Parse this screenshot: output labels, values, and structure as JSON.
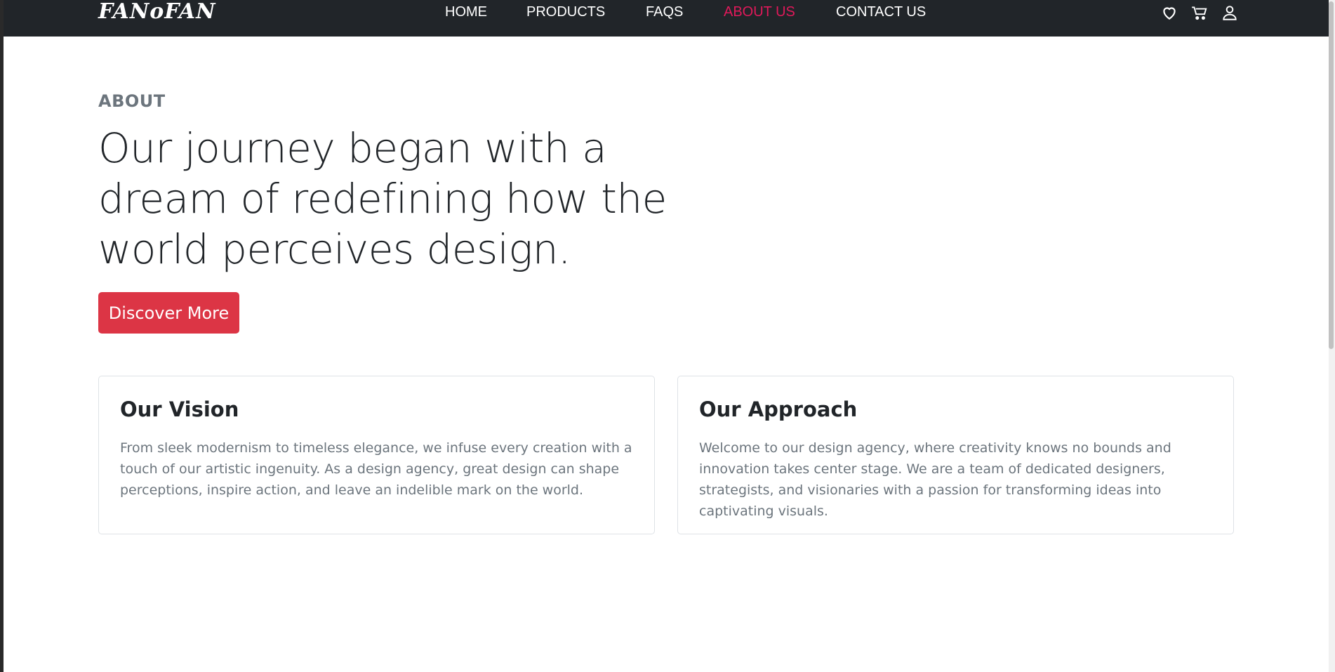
{
  "header": {
    "brand": "FANoFAN",
    "nav": [
      {
        "label": "HOME",
        "active": false
      },
      {
        "label": "PRODUCTS",
        "active": false
      },
      {
        "label": "FAQS",
        "active": false
      },
      {
        "label": "ABOUT US",
        "active": true
      },
      {
        "label": "CONTACT US",
        "active": false
      }
    ],
    "icons": [
      "heart-icon",
      "cart-icon",
      "user-icon"
    ]
  },
  "hero": {
    "eyebrow": "ABOUT",
    "headline": "Our journey began with a dream of redefining how the world perceives design.",
    "cta_label": "Discover More"
  },
  "cards": [
    {
      "title": "Our Vision",
      "text": "From sleek modernism to timeless elegance, we infuse every creation with a touch of our artistic ingenuity. As a design agency, great design can shape perceptions, inspire action, and leave an indelible mark on the world."
    },
    {
      "title": "Our Approach",
      "text": "Welcome to our design agency, where creativity knows no bounds and innovation takes center stage. We are a team of dedicated designers, strategists, and visionaries with a passion for transforming ideas into captivating visuals."
    }
  ],
  "colors": {
    "navbar_bg": "#212529",
    "active_link": "#e0195a",
    "cta_bg": "#dc3545",
    "muted_text": "#6c757d"
  }
}
